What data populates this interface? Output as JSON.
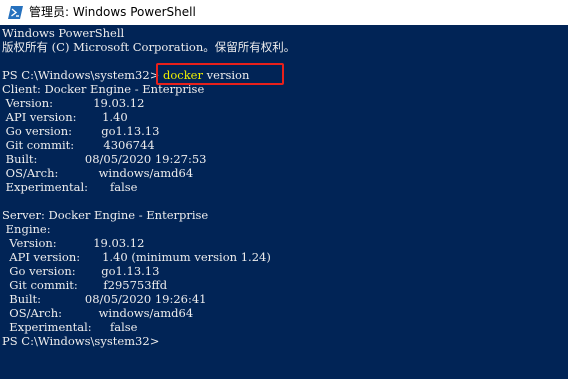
{
  "window": {
    "title": "管理员: Windows PowerShell",
    "icon": "powershell-icon"
  },
  "console": {
    "lines": [
      "Windows PowerShell",
      "版权所有 (C) Microsoft Corporation。保留所有权利。",
      "",
      "",
      "Client: Docker Engine - Enterprise",
      " Version:           19.03.12",
      " API version:       1.40",
      " Go version:        go1.13.13",
      " Git commit:        4306744",
      " Built:             08/05/2020 19:27:53",
      " OS/Arch:           windows/amd64",
      " Experimental:      false",
      "",
      "Server: Docker Engine - Enterprise",
      " Engine:",
      "  Version:          19.03.12",
      "  API version:      1.40 (minimum version 1.24)",
      "  Go version:       go1.13.13",
      "  Git commit:       f295753ffd",
      "  Built:            08/05/2020 19:26:41",
      "  OS/Arch:          windows/amd64",
      "  Experimental:     false"
    ],
    "prompt": "PS C:\\Windows\\system32>",
    "command_program": "docker",
    "command_args": "version",
    "final_prompt": "PS C:\\Windows\\system32>"
  },
  "colors": {
    "background": "#012456",
    "text": "#eeeded",
    "command": "#f0f000",
    "highlight_box": "#e8201b"
  }
}
